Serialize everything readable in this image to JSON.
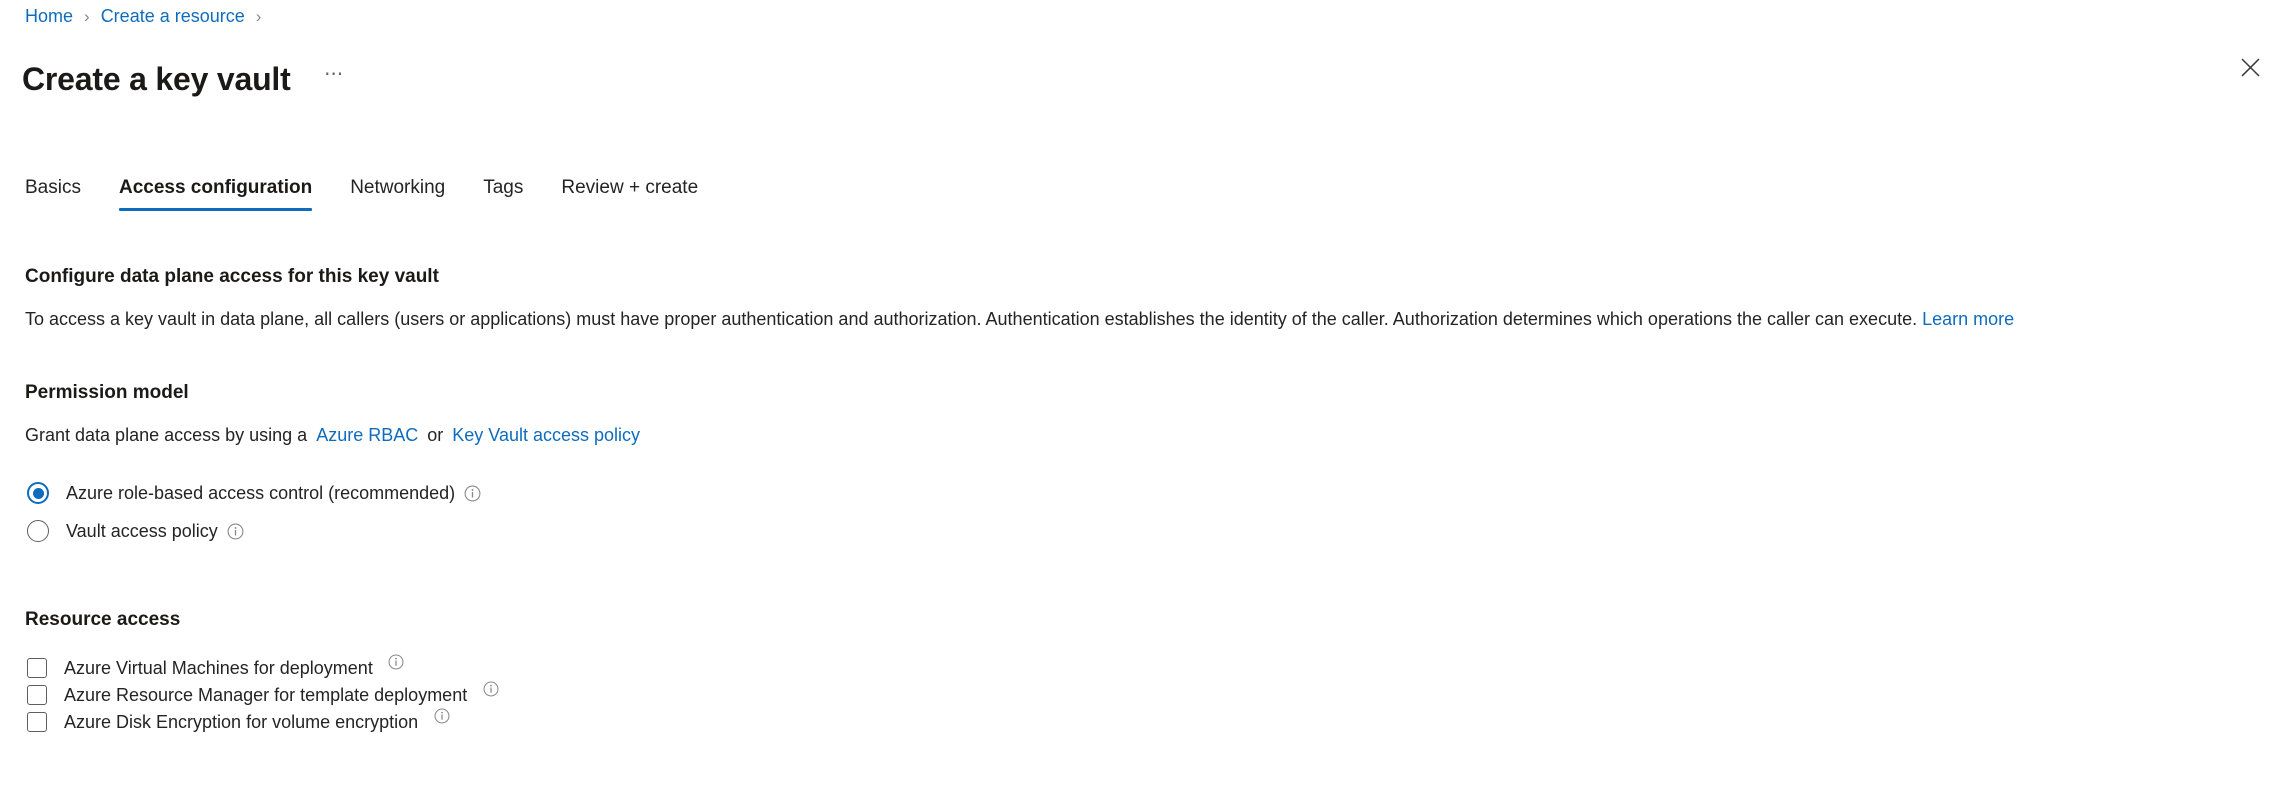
{
  "breadcrumb": {
    "items": [
      {
        "label": "Home"
      },
      {
        "label": "Create a resource"
      }
    ],
    "separator": "›"
  },
  "header": {
    "title": "Create a key vault",
    "more_label": "⋯",
    "close_icon": "close-icon"
  },
  "tabs": [
    {
      "label": "Basics",
      "active": false
    },
    {
      "label": "Access configuration",
      "active": true
    },
    {
      "label": "Networking",
      "active": false
    },
    {
      "label": "Tags",
      "active": false
    },
    {
      "label": "Review + create",
      "active": false
    }
  ],
  "main": {
    "configure": {
      "heading": "Configure data plane access for this key vault",
      "description": "To access a key vault in data plane, all callers (users or applications) must have proper authentication and authorization. Authentication establishes the identity of the caller. Authorization determines which operations the caller can execute.",
      "learn_more_label": "Learn more"
    },
    "permission_model": {
      "heading": "Permission model",
      "intro_prefix": "Grant data plane access by using a",
      "link_rbac": "Azure RBAC",
      "intro_middle": "or",
      "link_policy": "Key Vault access policy",
      "options": [
        {
          "label": "Azure role-based access control (recommended)",
          "selected": true,
          "info": "info-icon"
        },
        {
          "label": "Vault access policy",
          "selected": false,
          "info": "info-icon"
        }
      ]
    },
    "resource_access": {
      "heading": "Resource access",
      "options": [
        {
          "label": "Azure Virtual Machines for deployment",
          "checked": false,
          "info": "info-icon"
        },
        {
          "label": "Azure Resource Manager for template deployment",
          "checked": false,
          "info": "info-icon"
        },
        {
          "label": "Azure Disk Encryption for volume encryption",
          "checked": false,
          "info": "info-icon"
        }
      ]
    }
  },
  "colors": {
    "link": "#0f6cbd",
    "accent": "#0f6cbd",
    "text": "#242424",
    "border": "#605e5c",
    "background": "#ffffff"
  }
}
